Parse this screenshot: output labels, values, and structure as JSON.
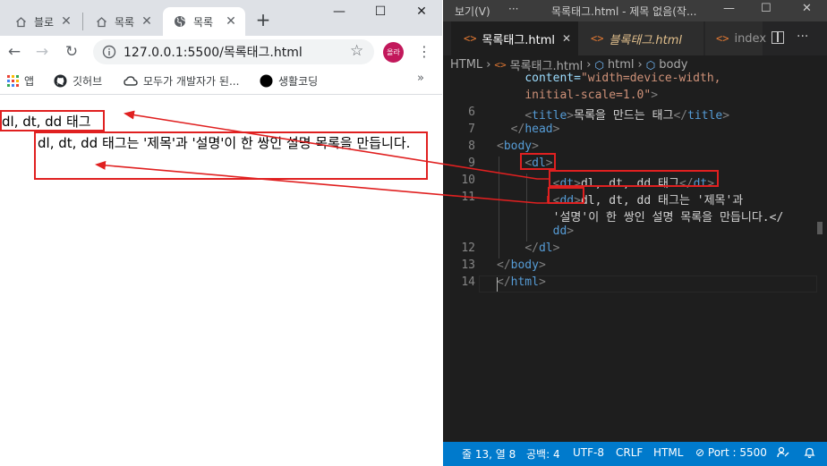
{
  "browser": {
    "tabs": [
      {
        "label": "블로",
        "icon": "home-icon",
        "active": false
      },
      {
        "label": "목록",
        "icon": "home-icon",
        "active": false
      },
      {
        "label": "목록",
        "icon": "globe-icon",
        "active": true
      }
    ],
    "new_tab": "+",
    "window_controls": {
      "minimize": "—",
      "maximize": "☐",
      "close": "✕"
    },
    "url": "127.0.0.1:5500/목록태그.html",
    "profile_label": "올라",
    "bookmarks": [
      {
        "label": "앱",
        "icon": "apps-grid-icon"
      },
      {
        "label": "깃허브",
        "icon": "github-icon"
      },
      {
        "label": "모두가 개발자가 된...",
        "icon": "cloud-icon"
      },
      {
        "label": "생활코딩",
        "icon": "black-circle-icon"
      }
    ],
    "bookmarks_more": "»"
  },
  "page": {
    "dt_text": "dl, dt, dd 태그",
    "dd_text": "dl, dt, dd 태그는 '제목'과 '설명'이 한 쌍인 설명 목록을 만듭니다."
  },
  "editor": {
    "menu_view": "보기(V)",
    "menu_more": "···",
    "title": "목록태그.html - 제목 없음(작...",
    "window_controls": {
      "minimize": "—",
      "maximize": "☐",
      "close": "✕"
    },
    "tabs": [
      {
        "label": "목록태그.html",
        "active": true,
        "close": "✕"
      },
      {
        "label": "블록태그.html",
        "active": false
      },
      {
        "label": "index",
        "active": false
      }
    ],
    "more": "···",
    "breadcrumb": {
      "root": "HTML",
      "file": "목록태그.html",
      "html": "html",
      "body": "body",
      "sep": "›"
    },
    "code_lines": [
      {
        "n": "",
        "indent": 4,
        "parts": [
          {
            "c": "a",
            "t": "content="
          },
          {
            "c": "s",
            "t": "\"width=device-width,"
          }
        ]
      },
      {
        "n": "",
        "indent": 4,
        "parts": [
          {
            "c": "s",
            "t": "initial-scale=1.0\""
          },
          {
            "c": "g",
            "t": ">"
          }
        ]
      },
      {
        "n": "6",
        "indent": 4,
        "parts": [
          {
            "c": "g",
            "t": "<"
          },
          {
            "c": "t",
            "t": "title"
          },
          {
            "c": "g",
            "t": ">"
          },
          {
            "c": "w",
            "t": "목록을 만드는 태그"
          },
          {
            "c": "g",
            "t": "</"
          },
          {
            "c": "t",
            "t": "title"
          },
          {
            "c": "g",
            "t": ">"
          }
        ]
      },
      {
        "n": "7",
        "indent": 2,
        "parts": [
          {
            "c": "g",
            "t": "</"
          },
          {
            "c": "t",
            "t": "head"
          },
          {
            "c": "g",
            "t": ">"
          }
        ]
      },
      {
        "n": "8",
        "indent": 0,
        "parts": [
          {
            "c": "g",
            "t": "<"
          },
          {
            "c": "t",
            "t": "body"
          },
          {
            "c": "g",
            "t": ">"
          }
        ]
      },
      {
        "n": "9",
        "indent": 4,
        "parts": [
          {
            "c": "g",
            "t": "<"
          },
          {
            "c": "t",
            "t": "dl"
          },
          {
            "c": "g",
            "t": ">"
          }
        ]
      },
      {
        "n": "10",
        "indent": 8,
        "parts": [
          {
            "c": "g",
            "t": "<"
          },
          {
            "c": "t",
            "t": "dt"
          },
          {
            "c": "g",
            "t": ">"
          },
          {
            "c": "w",
            "t": "dl, dt, dd 태그"
          },
          {
            "c": "g",
            "t": "</"
          },
          {
            "c": "t",
            "t": "dt"
          },
          {
            "c": "g",
            "t": ">"
          }
        ]
      },
      {
        "n": "11",
        "indent": 8,
        "parts": [
          {
            "c": "g",
            "t": "<"
          },
          {
            "c": "t",
            "t": "dd"
          },
          {
            "c": "g",
            "t": ">"
          },
          {
            "c": "w",
            "t": "dl, dt, dd 태그는 '제목'과"
          }
        ]
      },
      {
        "n": "",
        "indent": 8,
        "parts": [
          {
            "c": "w",
            "t": "'설명'이 한 쌍인 설명 목록을 만듭니다.</"
          }
        ]
      },
      {
        "n": "",
        "indent": 8,
        "parts": [
          {
            "c": "t",
            "t": "dd"
          },
          {
            "c": "g",
            "t": ">"
          }
        ]
      },
      {
        "n": "12",
        "indent": 4,
        "parts": [
          {
            "c": "g",
            "t": "</"
          },
          {
            "c": "t",
            "t": "dl"
          },
          {
            "c": "g",
            "t": ">"
          }
        ]
      },
      {
        "n": "13",
        "indent": 0,
        "parts": [
          {
            "c": "g",
            "t": "</"
          },
          {
            "c": "t",
            "t": "body"
          },
          {
            "c": "g",
            "t": ">"
          }
        ]
      },
      {
        "n": "14",
        "indent": 0,
        "parts": [
          {
            "c": "g",
            "t": "</"
          },
          {
            "c": "t",
            "t": "html"
          },
          {
            "c": "g",
            "t": ">"
          }
        ]
      }
    ],
    "status": {
      "position": "줄 13, 열 8",
      "spaces": "공백: 4",
      "encoding": "UTF-8",
      "eol": "CRLF",
      "language": "HTML",
      "port": "Port : 5500"
    }
  },
  "colors": {
    "status_bar": "#007acc",
    "annotation_red": "#e02020",
    "tag_blue": "#569cd6",
    "attr_light_blue": "#9cdcfe",
    "string_orange": "#ce9178"
  }
}
